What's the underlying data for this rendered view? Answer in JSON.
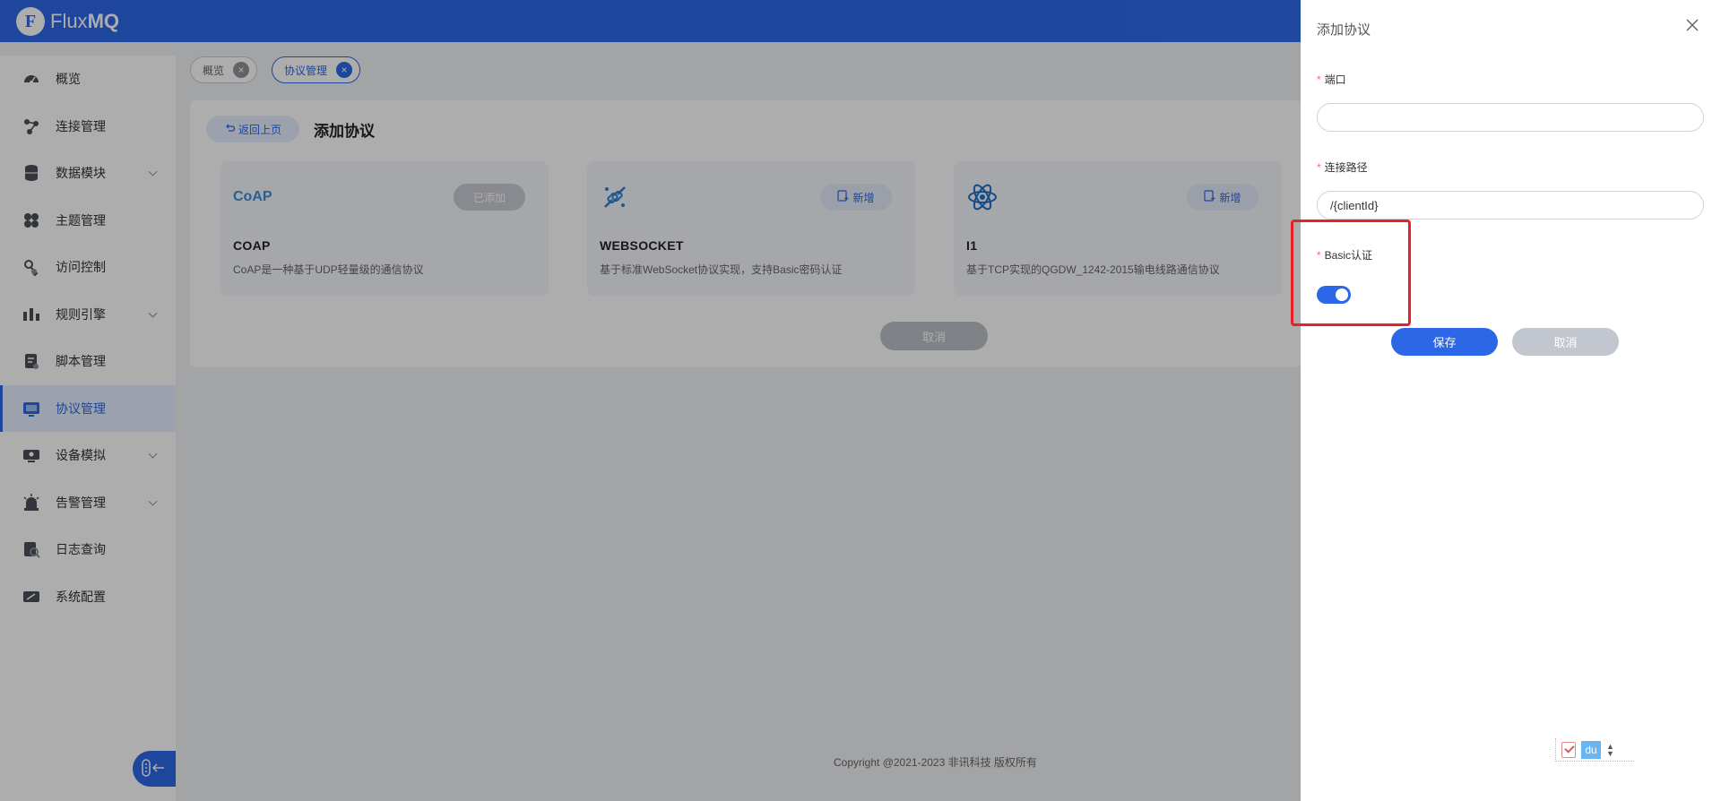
{
  "header": {
    "logo_text_light": "Flux",
    "logo_text_bold": "MQ"
  },
  "sidebar": {
    "items": [
      {
        "label": "概览",
        "icon": "dashboard-icon",
        "expandable": false
      },
      {
        "label": "连接管理",
        "icon": "connection-icon",
        "expandable": false
      },
      {
        "label": "数据模块",
        "icon": "database-icon",
        "expandable": true
      },
      {
        "label": "主题管理",
        "icon": "topic-icon",
        "expandable": false
      },
      {
        "label": "访问控制",
        "icon": "access-control-icon",
        "expandable": false
      },
      {
        "label": "规则引擎",
        "icon": "rule-engine-icon",
        "expandable": true
      },
      {
        "label": "脚本管理",
        "icon": "script-icon",
        "expandable": false
      },
      {
        "label": "协议管理",
        "icon": "protocol-icon",
        "expandable": false,
        "active": true
      },
      {
        "label": "设备模拟",
        "icon": "device-sim-icon",
        "expandable": true
      },
      {
        "label": "告警管理",
        "icon": "alarm-icon",
        "expandable": true
      },
      {
        "label": "日志查询",
        "icon": "log-icon",
        "expandable": false
      },
      {
        "label": "系统配置",
        "icon": "settings-icon",
        "expandable": false
      }
    ],
    "collapse_icon": "collapse-sidebar-icon"
  },
  "tabs": [
    {
      "label": "概览",
      "active": false
    },
    {
      "label": "协议管理",
      "active": true
    }
  ],
  "main": {
    "back_label": "返回上页",
    "title": "添加协议",
    "cancel_label": "取消",
    "protocols": [
      {
        "name": "COAP",
        "logo_text": "CoAP",
        "desc": "CoAP是一种基于UDP轻量级的通信协议",
        "button": "已添加",
        "state": "added"
      },
      {
        "name": "WEBSOCKET",
        "desc": "基于标准WebSocket协议实现，支持Basic密码认证",
        "button": "新增",
        "state": "new"
      },
      {
        "name": "I1",
        "desc": "基于TCP实现的QGDW_1242-2015输电线路通信协议",
        "button": "新增",
        "state": "new"
      }
    ]
  },
  "footer": {
    "copyright": "Copyright @2021-2023 非讯科技 版权所有"
  },
  "drawer": {
    "title": "添加协议",
    "port_label": "端口",
    "port_value": "",
    "path_label": "连接路径",
    "path_value": "/{clientId}",
    "basic_auth_label": "Basic认证",
    "basic_auth_enabled": true,
    "save_label": "保存",
    "cancel_label": "取消",
    "required_mark": "*"
  },
  "mini_toolbar": {
    "du_label": "du"
  },
  "colors": {
    "primary": "#2b67e6",
    "highlight": "#e8202a",
    "required": "#f56c6c"
  }
}
